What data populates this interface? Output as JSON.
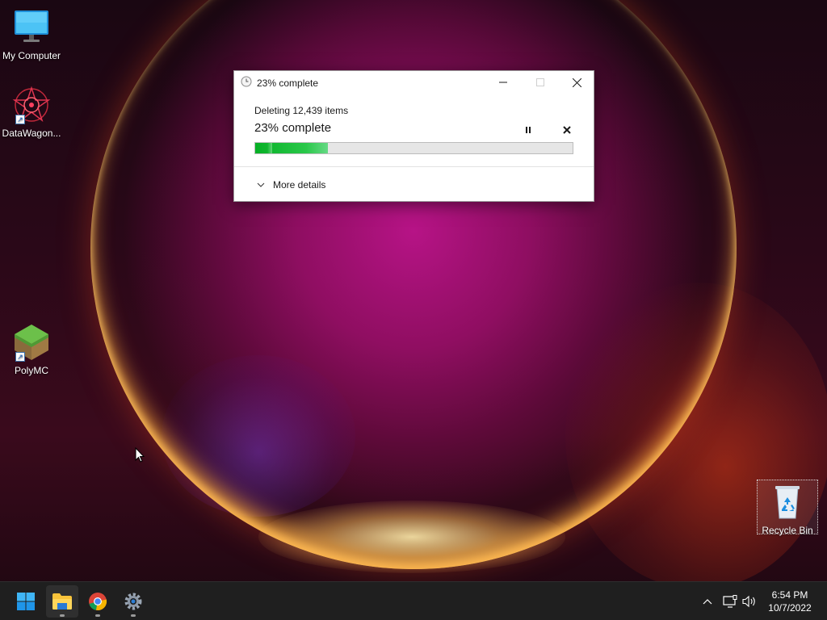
{
  "desktop": {
    "icons": [
      {
        "name": "My Computer",
        "icon": "monitor-icon"
      },
      {
        "name": "DataWagon...",
        "icon": "datawagon-icon"
      },
      {
        "name": "PolyMC",
        "icon": "polymc-icon"
      },
      {
        "name": "Recycle Bin",
        "icon": "recycle-bin-icon"
      }
    ]
  },
  "dialog": {
    "title": "23% complete",
    "operation": "Deleting 12,439 items",
    "percent_text": "23% complete",
    "progress": 0.23,
    "more_details": "More details",
    "progress_color": "#06b025"
  },
  "taskbar": {
    "apps": [
      {
        "name": "Start",
        "icon": "windows-start-icon"
      },
      {
        "name": "File Explorer",
        "icon": "folder-icon",
        "active": true
      },
      {
        "name": "Google Chrome",
        "icon": "chrome-icon",
        "running": true
      },
      {
        "name": "Settings",
        "icon": "gear-icon",
        "running": true
      }
    ],
    "tray": [
      "chevron-up-icon",
      "network-icon",
      "volume-icon"
    ],
    "time": "6:54 PM",
    "date": "10/7/2022"
  }
}
